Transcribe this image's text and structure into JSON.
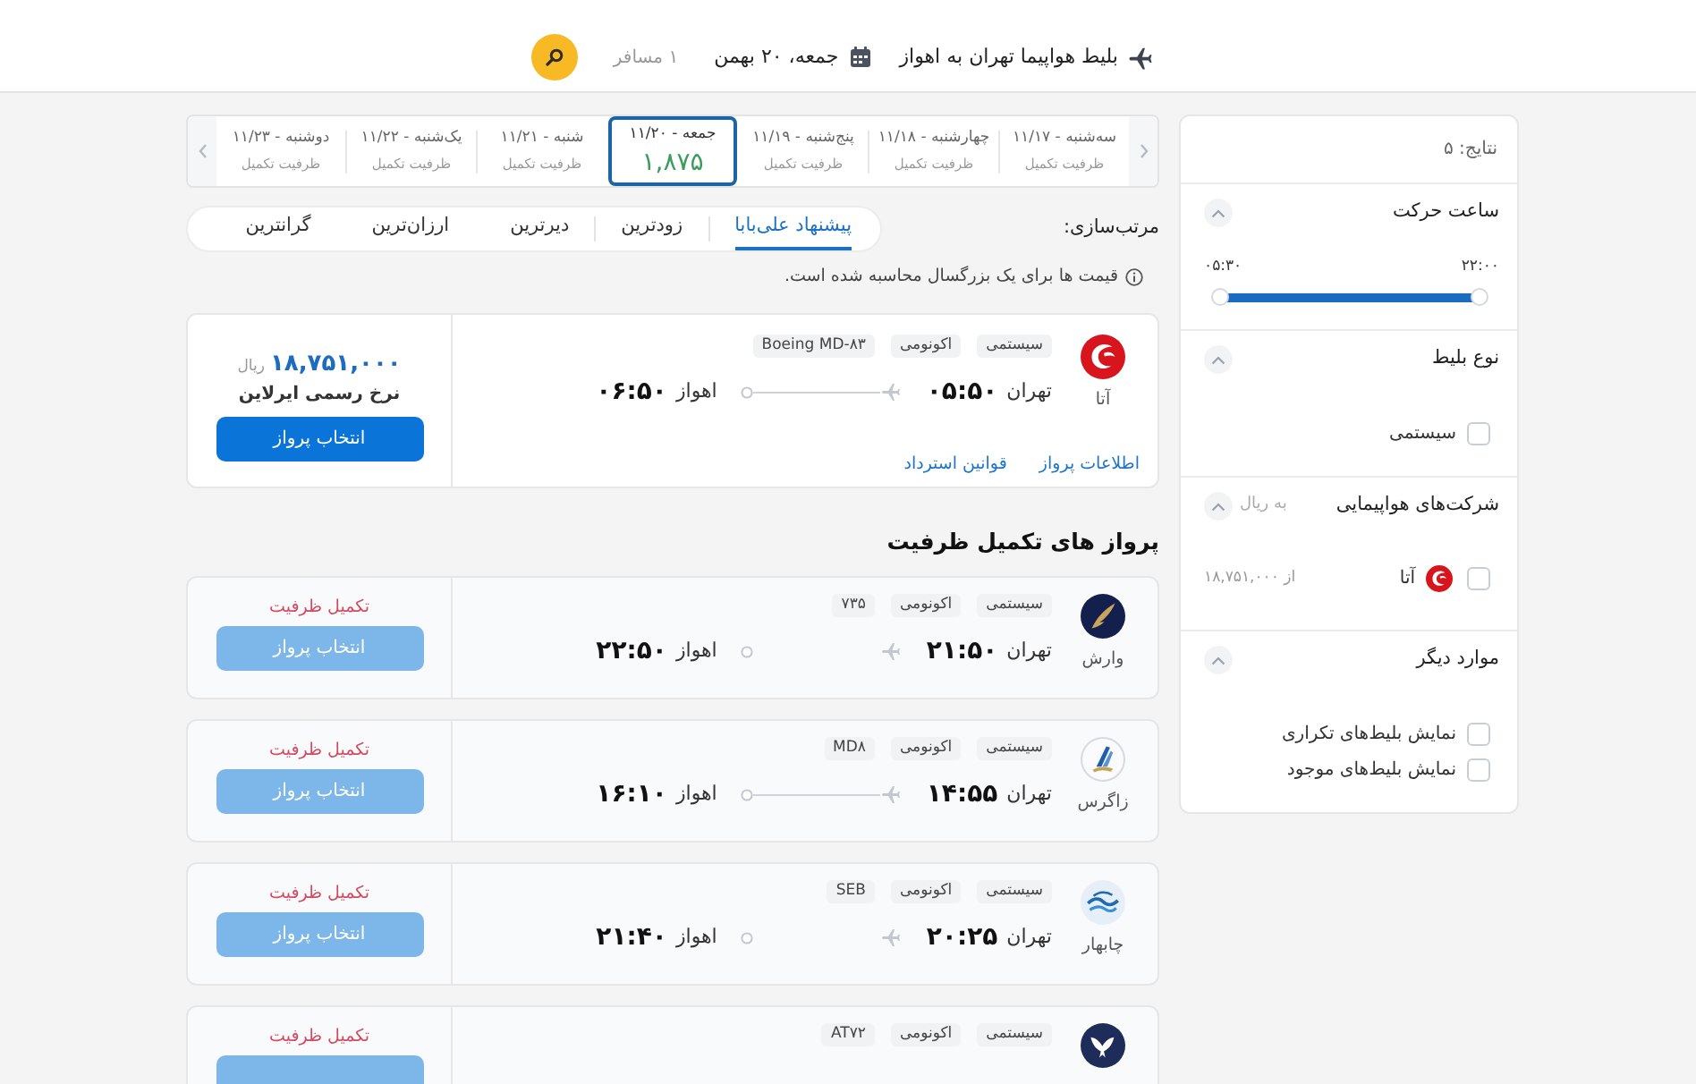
{
  "header": {
    "title": "بلیط هواپیما تهران به اهواز",
    "date": "جمعه، ۲۰ بهمن",
    "passengers": "۱ مسافر"
  },
  "date_strip": {
    "days": [
      {
        "label": "سه‌شنبه - ۱۱/۱۷",
        "status": "ظرفیت تکمیل",
        "selected": false
      },
      {
        "label": "چهارشنبه - ۱۱/۱۸",
        "status": "ظرفیت تکمیل",
        "selected": false
      },
      {
        "label": "پنج‌شنبه - ۱۱/۱۹",
        "status": "ظرفیت تکمیل",
        "selected": false
      },
      {
        "label": "جمعه - ۱۱/۲۰",
        "price": "۱,۸۷۵",
        "selected": true
      },
      {
        "label": "شنبه - ۱۱/۲۱",
        "status": "ظرفیت تکمیل",
        "selected": false
      },
      {
        "label": "یک‌شنبه - ۱۱/۲۲",
        "status": "ظرفیت تکمیل",
        "selected": false
      },
      {
        "label": "دوشنبه - ۱۱/۲۳",
        "status": "ظرفیت تکمیل",
        "selected": false
      }
    ]
  },
  "sort": {
    "label": "مرتب‌سازی:",
    "options": [
      {
        "label": "پیشنهاد علی‌بابا",
        "selected": true
      },
      {
        "label": "زودترین",
        "selected": false
      },
      {
        "label": "دیرترین",
        "selected": false
      },
      {
        "label": "ارزان‌ترین",
        "selected": false
      },
      {
        "label": "گرانترین",
        "selected": false
      }
    ]
  },
  "notice": "قیمت ها برای یک بزرگسال محاسبه شده است.",
  "flights": [
    {
      "kind": "swirl",
      "airline": "آتا",
      "tags": {
        "ticket_type": "سیستمی",
        "cabin": "اکونومی",
        "aircraft": "Boeing MD-۸۳"
      },
      "departure": {
        "city": "تهران",
        "time": "۰۵:۵۰"
      },
      "arrival": {
        "city": "اهواز",
        "time": "۰۶:۵۰"
      },
      "route_line": true,
      "links": [
        "اطلاعات پرواز",
        "قوانین استرداد"
      ],
      "price": "۱۸,۷۵۱,۰۰۰",
      "currency": "ریال",
      "fare_note": "نرخ رسمی ایرلاین",
      "button": {
        "label": "انتخاب پرواز",
        "disabled": false
      }
    }
  ],
  "sold_out": {
    "title": "پرواز های تکمیل ظرفیت",
    "flights": [
      {
        "kind": "feather",
        "airline": "وارش",
        "tags": {
          "ticket_type": "سیستمی",
          "cabin": "اکونومی",
          "aircraft": "۷۳۵"
        },
        "departure": {
          "city": "تهران",
          "time": "۲۱:۵۰"
        },
        "arrival": {
          "city": "اهواز",
          "time": "۲۲:۵۰"
        },
        "route_line": false,
        "status": "تکمیل ظرفیت",
        "button": {
          "label": "انتخاب پرواز",
          "disabled": true
        }
      },
      {
        "kind": "tail",
        "airline": "زاگرس",
        "tags": {
          "ticket_type": "سیستمی",
          "cabin": "اکونومی",
          "aircraft": "MD۸"
        },
        "departure": {
          "city": "تهران",
          "time": "۱۴:۵۵"
        },
        "arrival": {
          "city": "اهواز",
          "time": "۱۶:۱۰"
        },
        "route_line": true,
        "status": "تکمیل ظرفیت",
        "button": {
          "label": "انتخاب پرواز",
          "disabled": true
        }
      },
      {
        "kind": "wave",
        "airline": "چابهار",
        "tags": {
          "ticket_type": "سیستمی",
          "cabin": "اکونومی",
          "aircraft": "SEB"
        },
        "departure": {
          "city": "تهران",
          "time": "۲۰:۲۵"
        },
        "arrival": {
          "city": "اهواز",
          "time": "۲۱:۴۰"
        },
        "route_line": false,
        "status": "تکمیل ظرفیت",
        "button": {
          "label": "انتخاب پرواز",
          "disabled": true
        }
      },
      {
        "kind": "bird",
        "tags": {
          "ticket_type": "سیستمی",
          "cabin": "اکونومی",
          "aircraft": "AT۷۲"
        },
        "status": "تکمیل ظرفیت",
        "button": {
          "disabled": true
        }
      }
    ]
  },
  "filters": {
    "results": "نتایج: ۵",
    "sections": [
      {
        "kind": "range",
        "title": "ساعت حرکت",
        "expanded": true,
        "labels": [
          "۲۲:۰۰",
          "۰۵:۳۰"
        ],
        "level": 1
      },
      {
        "kind": "checklist",
        "title": "نوع بلیط",
        "expanded": true,
        "items": [
          {
            "label": "سیستمی",
            "checked": false
          }
        ]
      },
      {
        "kind": "airlines",
        "title": "شرکت‌های هواپیمایی",
        "note": "به ریال",
        "expanded": true,
        "items": [
          {
            "kind": "swirl",
            "label": "آتا",
            "price": "از ۱۸,۷۵۱,۰۰۰",
            "checked": false
          }
        ]
      },
      {
        "kind": "checklist",
        "title": "موارد دیگر",
        "expanded": true,
        "items": [
          {
            "label": "نمایش بلیط‌های تکراری",
            "checked": false
          },
          {
            "label": "نمایش بلیط‌های موجود",
            "checked": false
          }
        ]
      }
    ]
  }
}
